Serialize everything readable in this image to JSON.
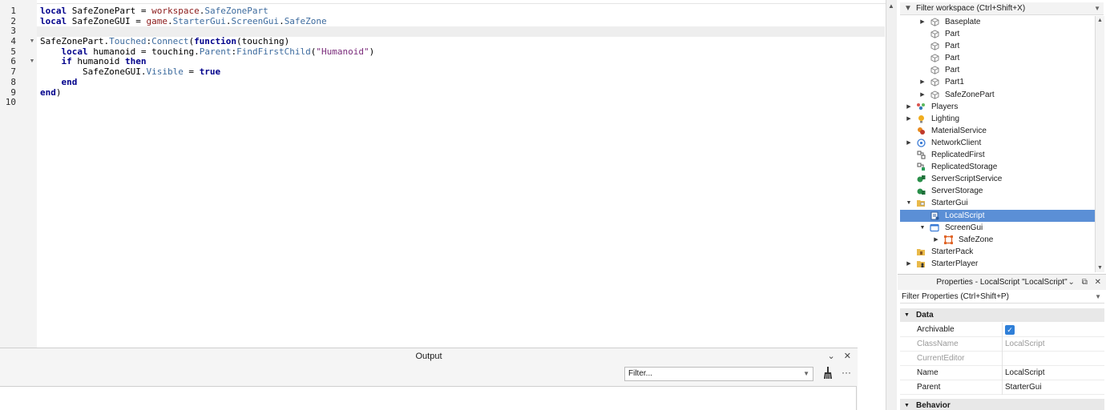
{
  "editor": {
    "line_numbers": [
      "1",
      "2",
      "3",
      "4",
      "5",
      "6",
      "7",
      "8",
      "9",
      "10"
    ],
    "current_line": 3,
    "lines": [
      [
        {
          "t": "kw",
          "v": "local"
        },
        {
          "t": "pl",
          "v": " SafeZonePart = "
        },
        {
          "t": "gl",
          "v": "workspace"
        },
        {
          "t": "pl",
          "v": "."
        },
        {
          "t": "pr",
          "v": "SafeZonePart"
        }
      ],
      [
        {
          "t": "kw",
          "v": "local"
        },
        {
          "t": "pl",
          "v": " SafeZoneGUI = "
        },
        {
          "t": "gl",
          "v": "game"
        },
        {
          "t": "pl",
          "v": "."
        },
        {
          "t": "pr",
          "v": "StarterGui"
        },
        {
          "t": "pl",
          "v": "."
        },
        {
          "t": "pr",
          "v": "ScreenGui"
        },
        {
          "t": "pl",
          "v": "."
        },
        {
          "t": "pr",
          "v": "SafeZone"
        }
      ],
      [],
      [
        {
          "t": "pl",
          "v": "SafeZonePart."
        },
        {
          "t": "pr",
          "v": "Touched"
        },
        {
          "t": "pl",
          "v": ":"
        },
        {
          "t": "pr",
          "v": "Connect"
        },
        {
          "t": "pl",
          "v": "("
        },
        {
          "t": "kw",
          "v": "function"
        },
        {
          "t": "pl",
          "v": "(touching)"
        }
      ],
      [
        {
          "t": "pl",
          "v": "    "
        },
        {
          "t": "kw",
          "v": "local"
        },
        {
          "t": "pl",
          "v": " humanoid = touching."
        },
        {
          "t": "pr",
          "v": "Parent"
        },
        {
          "t": "pl",
          "v": ":"
        },
        {
          "t": "pr",
          "v": "FindFirstChild"
        },
        {
          "t": "pl",
          "v": "("
        },
        {
          "t": "st",
          "v": "\"Humanoid\""
        },
        {
          "t": "pl",
          "v": ")"
        }
      ],
      [
        {
          "t": "pl",
          "v": "    "
        },
        {
          "t": "kw",
          "v": "if"
        },
        {
          "t": "pl",
          "v": " humanoid "
        },
        {
          "t": "kw",
          "v": "then"
        }
      ],
      [
        {
          "t": "pl",
          "v": "        SafeZoneGUI."
        },
        {
          "t": "pr",
          "v": "Visible"
        },
        {
          "t": "pl",
          "v": " = "
        },
        {
          "t": "bo",
          "v": "true"
        }
      ],
      [
        {
          "t": "pl",
          "v": "    "
        },
        {
          "t": "kw",
          "v": "end"
        }
      ],
      [
        {
          "t": "kw",
          "v": "end"
        },
        {
          "t": "pl",
          "v": ")"
        }
      ],
      []
    ],
    "fold_markers": [
      "",
      "",
      "",
      "chevron-down-icon",
      "",
      "chevron-down-icon",
      "",
      "",
      "",
      ""
    ]
  },
  "output": {
    "title": "Output",
    "filter_placeholder": "Filter...",
    "chevron": "⌄",
    "close": "✕",
    "more": "···"
  },
  "explorer": {
    "filter_placeholder": "Filter workspace (Ctrl+Shift+X)",
    "items": [
      {
        "label": "Baseplate",
        "indent": 1,
        "arrow": "right",
        "icon": "part-icon",
        "selected": false
      },
      {
        "label": "Part",
        "indent": 1,
        "arrow": "",
        "icon": "part-icon",
        "selected": false
      },
      {
        "label": "Part",
        "indent": 1,
        "arrow": "",
        "icon": "part-icon",
        "selected": false
      },
      {
        "label": "Part",
        "indent": 1,
        "arrow": "",
        "icon": "part-icon",
        "selected": false
      },
      {
        "label": "Part",
        "indent": 1,
        "arrow": "",
        "icon": "part-icon",
        "selected": false
      },
      {
        "label": "Part1",
        "indent": 1,
        "arrow": "right",
        "icon": "part-icon",
        "selected": false
      },
      {
        "label": "SafeZonePart",
        "indent": 1,
        "arrow": "right",
        "icon": "part-icon",
        "selected": false
      },
      {
        "label": "Players",
        "indent": 0,
        "arrow": "right",
        "icon": "players-icon",
        "selected": false
      },
      {
        "label": "Lighting",
        "indent": 0,
        "arrow": "right",
        "icon": "lighting-icon",
        "selected": false
      },
      {
        "label": "MaterialService",
        "indent": 0,
        "arrow": "",
        "icon": "material-service-icon",
        "selected": false
      },
      {
        "label": "NetworkClient",
        "indent": 0,
        "arrow": "right",
        "icon": "network-client-icon",
        "selected": false
      },
      {
        "label": "ReplicatedFirst",
        "indent": 0,
        "arrow": "",
        "icon": "replicated-first-icon",
        "selected": false
      },
      {
        "label": "ReplicatedStorage",
        "indent": 0,
        "arrow": "",
        "icon": "replicated-storage-icon",
        "selected": false
      },
      {
        "label": "ServerScriptService",
        "indent": 0,
        "arrow": "",
        "icon": "server-script-service-icon",
        "selected": false
      },
      {
        "label": "ServerStorage",
        "indent": 0,
        "arrow": "",
        "icon": "server-storage-icon",
        "selected": false
      },
      {
        "label": "StarterGui",
        "indent": 0,
        "arrow": "down",
        "icon": "starter-gui-icon",
        "selected": false
      },
      {
        "label": "LocalScript",
        "indent": 1,
        "arrow": "",
        "icon": "local-script-icon",
        "selected": true
      },
      {
        "label": "ScreenGui",
        "indent": 1,
        "arrow": "down",
        "icon": "screen-gui-icon",
        "selected": false
      },
      {
        "label": "SafeZone",
        "indent": 2,
        "arrow": "right",
        "icon": "frame-icon",
        "selected": false
      },
      {
        "label": "StarterPack",
        "indent": 0,
        "arrow": "",
        "icon": "starter-pack-icon",
        "selected": false
      },
      {
        "label": "StarterPlayer",
        "indent": 0,
        "arrow": "right",
        "icon": "starter-player-icon",
        "selected": false
      }
    ]
  },
  "properties": {
    "title": "Properties - LocalScript \"LocalScript\"",
    "filter_placeholder": "Filter Properties (Ctrl+Shift+P)",
    "categories": {
      "data": "Data",
      "behavior": "Behavior"
    },
    "rows": [
      {
        "key": "Archivable",
        "value": "",
        "checkbox": true,
        "dim": false
      },
      {
        "key": "ClassName",
        "value": "LocalScript",
        "checkbox": false,
        "dim": true
      },
      {
        "key": "CurrentEditor",
        "value": "",
        "checkbox": false,
        "dim": true
      },
      {
        "key": "Name",
        "value": "LocalScript",
        "checkbox": false,
        "dim": false
      },
      {
        "key": "Parent",
        "value": "StarterGui",
        "checkbox": false,
        "dim": false
      }
    ]
  },
  "colors": {
    "selection": "#5b8fd6",
    "keyword": "#00008b",
    "global": "#8b1a1a",
    "property": "#3d6b9e",
    "string": "#7a2a7a",
    "checkbox": "#2f7fd8"
  }
}
